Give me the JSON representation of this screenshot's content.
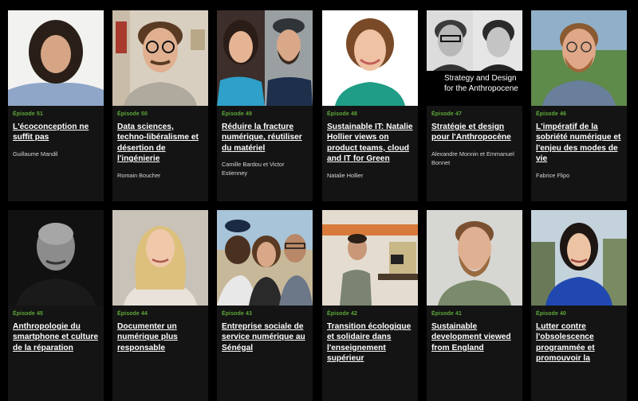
{
  "episodes": [
    {
      "label": "Épisode 51",
      "title": "L'écoconception ne suffit pas",
      "authors": "Guillaume Mandil"
    },
    {
      "label": "Épisode 50",
      "title": "Data sciences, techno-libéralisme et désertion de l'ingénierie",
      "authors": "Romain Boucher"
    },
    {
      "label": "Épisode 49",
      "title": "Réduire la fracture numérique, réutiliser du matériel",
      "authors": "Camille Bardou et Victor Estienney"
    },
    {
      "label": "Épisode 48",
      "title": "Sustainable IT: Natalie Hollier views on product teams, cloud and IT for Green",
      "authors": "Natalie Hollier"
    },
    {
      "label": "Épisode 47",
      "title": "Stratégie et design pour l'Anthropocène",
      "authors": "Alexandre Monnin et Emmanuel Bonnet",
      "image_caption": "Strategy and Design for the Anthropocene"
    },
    {
      "label": "Épisode 46",
      "title": "L'impératif de la sobriété numérique et l'enjeu des modes de vie",
      "authors": "Fabrice Flipo"
    },
    {
      "label": "Épisode 45",
      "title": "Anthropologie du smartphone et culture de la réparation",
      "authors": ""
    },
    {
      "label": "Épisode 44",
      "title": "Documenter un numérique plus responsable",
      "authors": ""
    },
    {
      "label": "Épisode 43",
      "title": "Entreprise sociale de service numérique au Sénégal",
      "authors": ""
    },
    {
      "label": "Épisode 42",
      "title": "Transition écologique et solidaire dans l'enseignement supérieur",
      "authors": ""
    },
    {
      "label": "Épisode 41",
      "title": "Sustainable development viewed from England",
      "authors": ""
    },
    {
      "label": "Épisode 40",
      "title": "Lutter contre l'obsolescence programmée et promouvoir la",
      "authors": ""
    }
  ]
}
